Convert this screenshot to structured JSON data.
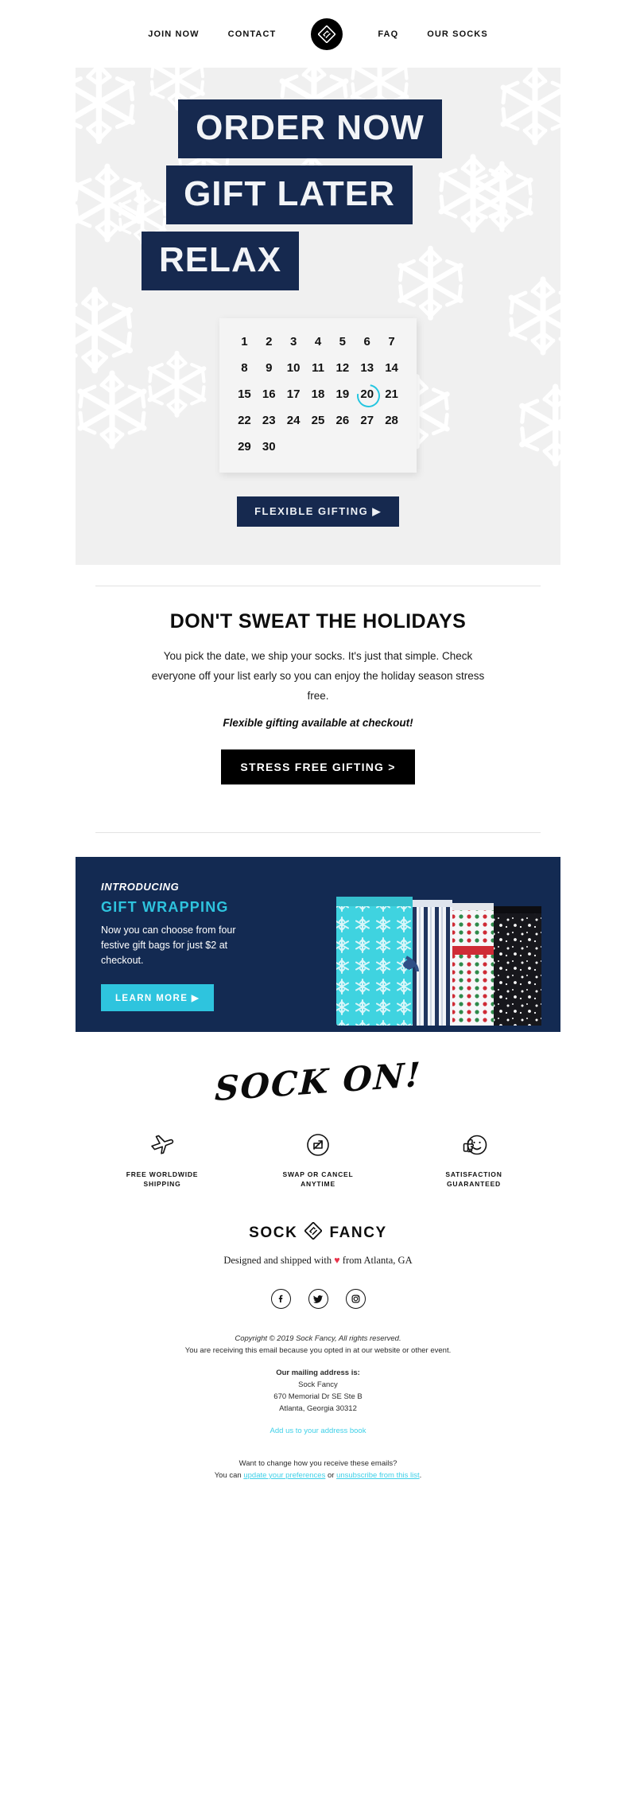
{
  "nav": {
    "links_left": [
      {
        "label": "JOIN NOW",
        "name": "nav-join-now"
      },
      {
        "label": "CONTACT",
        "name": "nav-contact"
      }
    ],
    "logo_icon": "sock-fancy-diamond-logo-icon",
    "links_right": [
      {
        "label": "FAQ",
        "name": "nav-faq"
      },
      {
        "label": "OUR SOCKS",
        "name": "nav-our-socks"
      }
    ]
  },
  "hero": {
    "headline_lines": [
      "ORDER NOW",
      "GIFT LATER",
      "RELAX"
    ],
    "background_color": "#f0f0f0",
    "band_color": "#16294f",
    "snowflake_color": "#ffffff",
    "calendar": {
      "days": [
        1,
        2,
        3,
        4,
        5,
        6,
        7,
        8,
        9,
        10,
        11,
        12,
        13,
        14,
        15,
        16,
        17,
        18,
        19,
        20,
        21,
        22,
        23,
        24,
        25,
        26,
        27,
        28,
        29,
        30
      ],
      "marked_day": 20,
      "marker_color": "#25c6e0"
    },
    "cta": {
      "label": "FLEXIBLE GIFTING",
      "arrow": "▶"
    }
  },
  "mid": {
    "title": "DON'T SWEAT THE HOLIDAYS",
    "paragraph": "You pick the date, we ship your socks. It's just that simple. Check everyone off your list early so you can enjoy the holiday season stress free.",
    "emphasis": "Flexible gifting available at checkout!",
    "cta": "STRESS FREE GIFTING >"
  },
  "gift_banner": {
    "kicker": "INTRODUCING",
    "title": "GIFT WRAPPING",
    "copy": "Now you can choose from four festive gift bags for just $2 at checkout.",
    "cta": "LEARN MORE",
    "cta_arrow": "▶",
    "background_color": "#132a52",
    "accent_color": "#2ec4de",
    "bags": [
      {
        "name": "snowflake-gift-bag",
        "base": "#3fd3e0",
        "pattern": "snowflakes"
      },
      {
        "name": "striped-gift-bag",
        "base": "#eef2f7",
        "pattern": "stripes"
      },
      {
        "name": "polka-dot-gift-bag",
        "base": "#f4f6f8",
        "pattern": "dots"
      },
      {
        "name": "starry-night-gift-bag",
        "base": "#1b1b1f",
        "pattern": "stars"
      }
    ]
  },
  "sock_on": {
    "text": "SOCK ON!"
  },
  "benefits": [
    {
      "icon": "airplane-icon",
      "label": "FREE WORLDWIDE SHIPPING"
    },
    {
      "icon": "swap-arrows-circle-icon",
      "label": "SWAP OR CANCEL ANYTIME"
    },
    {
      "icon": "thumbs-up-smiley-icon",
      "label": "SATISFACTION GUARANTEED"
    }
  ],
  "footer": {
    "brand_left": "SOCK",
    "brand_icon": "diamond-logo-icon",
    "brand_right": "FANCY",
    "tagline_before": "Designed and shipped with ",
    "tagline_heart": "♥",
    "tagline_after": " from Atlanta, GA",
    "socials": [
      {
        "icon": "facebook-icon",
        "glyph": "f"
      },
      {
        "icon": "twitter-icon",
        "glyph": "t"
      },
      {
        "icon": "instagram-icon",
        "glyph": "i"
      }
    ],
    "copyright": "Copyright © 2019 Sock Fancy, All rights reserved.",
    "opt_in_notice": "You are receiving this email because you opted in at our website or other event.",
    "address_heading": "Our mailing address is:",
    "address_line1": "Sock Fancy",
    "address_line2": "670 Memorial Dr SE Ste B",
    "address_line3": "Atlanta, Georgia 30312",
    "address_book_link": "Add us to your address book",
    "prefs_question": "Want to change how you receive these emails?",
    "prefs_prefix": "You can ",
    "prefs_link1": "update your preferences",
    "prefs_middle": " or ",
    "prefs_link2": "unsubscribe from this list",
    "prefs_suffix": "."
  }
}
